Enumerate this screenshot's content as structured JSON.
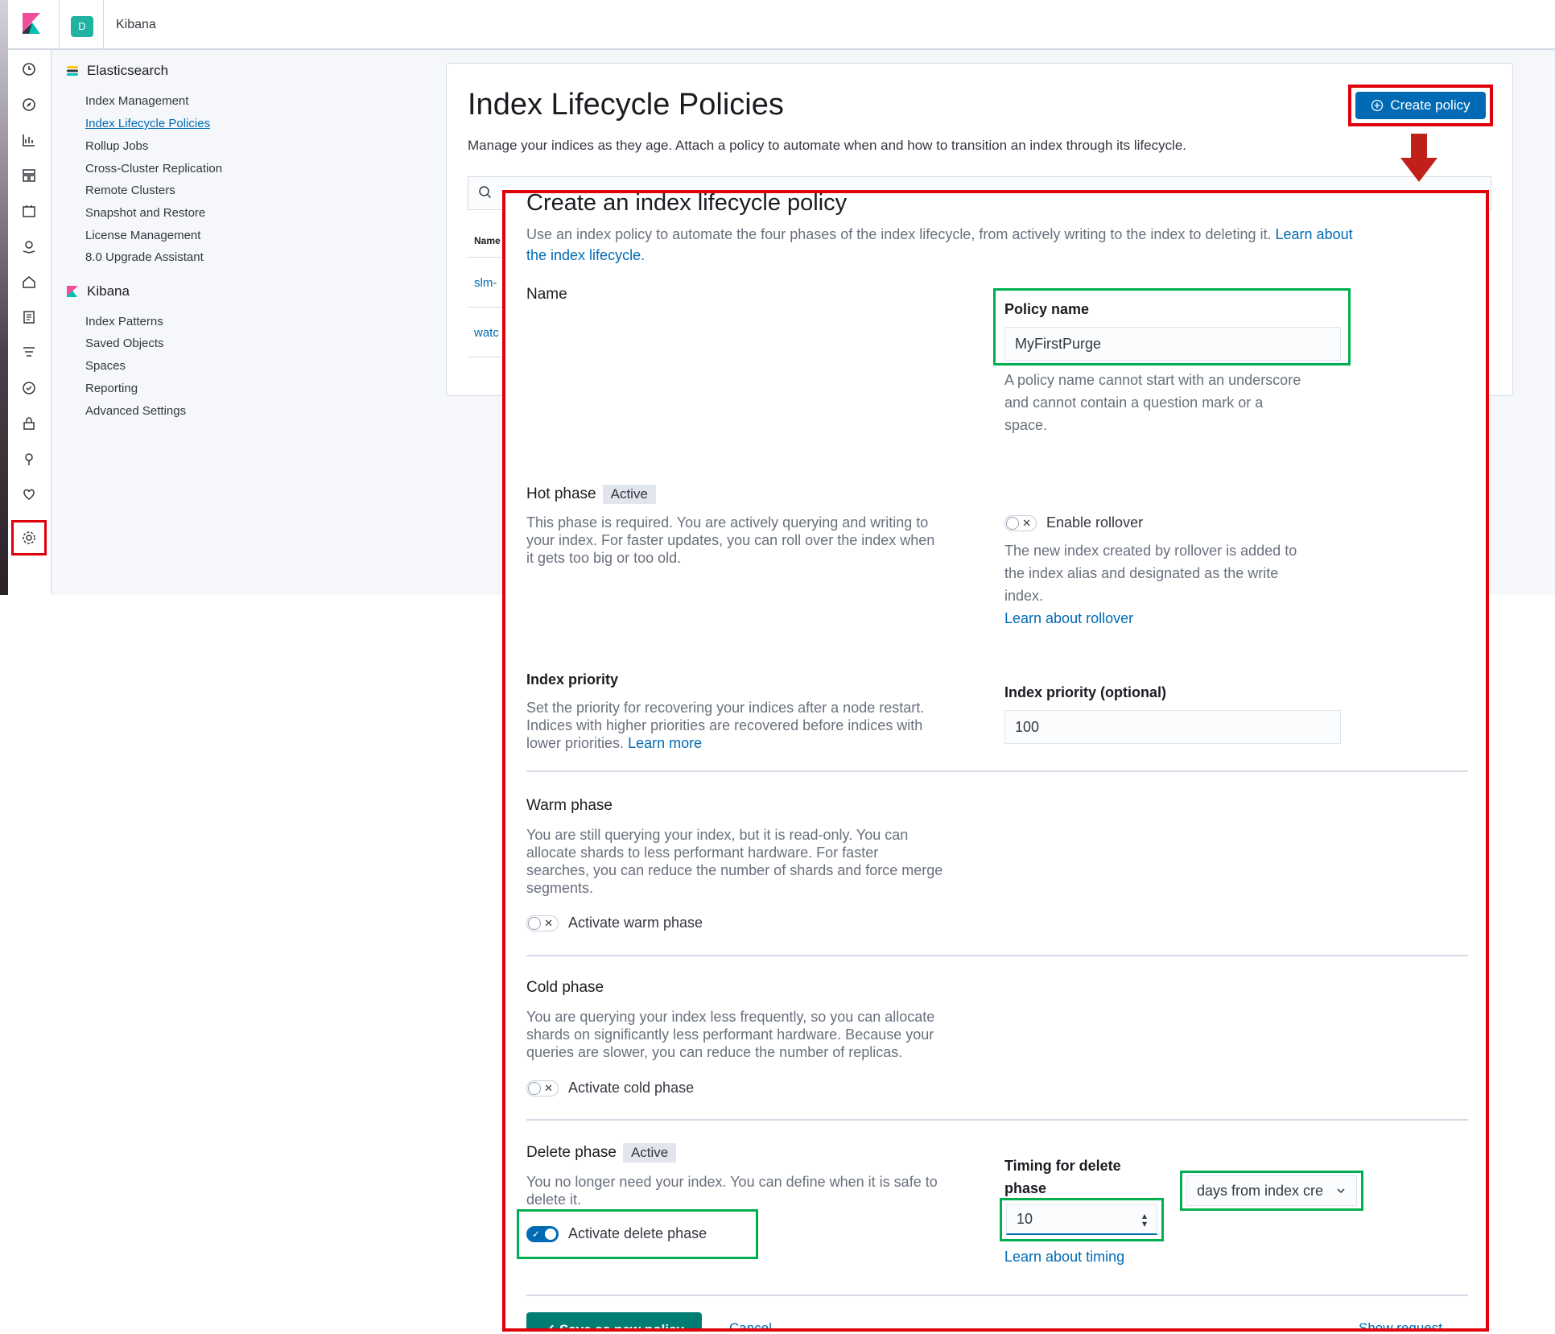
{
  "topbar": {
    "space_initial": "D",
    "app_title": "Kibana"
  },
  "sidebar": {
    "elasticsearch_title": "Elasticsearch",
    "elasticsearch_items": [
      "Index Management",
      "Index Lifecycle Policies",
      "Rollup Jobs",
      "Cross-Cluster Replication",
      "Remote Clusters",
      "Snapshot and Restore",
      "License Management",
      "8.0 Upgrade Assistant"
    ],
    "kibana_title": "Kibana",
    "kibana_items": [
      "Index Patterns",
      "Saved Objects",
      "Spaces",
      "Reporting",
      "Advanced Settings"
    ]
  },
  "main": {
    "title": "Index Lifecycle Policies",
    "description": "Manage your indices as they age. Attach a policy to automate when and how to transition an index through its lifecycle.",
    "create_button": "Create policy",
    "table_header_name": "Name",
    "rows": [
      "slm-",
      "watc"
    ]
  },
  "flyout": {
    "title": "Create an index lifecycle policy",
    "intro": "Use an index policy to automate the four phases of the index lifecycle, from actively writing to the index to deleting it.",
    "intro_link_1": "Learn about",
    "intro_link_2": "the index lifecycle.",
    "name_section": {
      "title": "Name",
      "field_label": "Policy name",
      "field_value": "MyFirstPurge",
      "help_lines": [
        "A policy name cannot start with an underscore",
        "and cannot contain a question mark or a",
        "space."
      ]
    },
    "hot_phase": {
      "title": "Hot phase",
      "badge": "Active",
      "desc_lines": [
        "This phase is required. You are actively querying and writing to",
        "your index. For faster updates, you can roll over the index when",
        "it gets too big or too old."
      ],
      "toggle_label": "Enable rollover",
      "toggle_on": false,
      "rollover_help_lines": [
        "The new index created by rollover is added to",
        "the index alias and designated as the write",
        "index."
      ],
      "rollover_link": "Learn about rollover"
    },
    "index_priority": {
      "title": "Index priority",
      "desc_lines": [
        "Set the priority for recovering your indices after a node restart.",
        "Indices with higher priorities are recovered before indices with",
        "lower priorities."
      ],
      "learn_more": "Learn more",
      "field_label": "Index priority (optional)",
      "field_value": "100"
    },
    "warm_phase": {
      "title": "Warm phase",
      "desc_lines": [
        "You are still querying your index, but it is read-only. You can",
        "allocate shards to less performant hardware. For faster",
        "searches, you can reduce the number of shards and force merge",
        "segments."
      ],
      "toggle_label": "Activate warm phase",
      "toggle_on": false
    },
    "cold_phase": {
      "title": "Cold phase",
      "desc_lines": [
        "You are querying your index less frequently, so you can allocate",
        "shards on significantly less performant hardware. Because your",
        "queries are slower, you can reduce the number of replicas."
      ],
      "toggle_label": "Activate cold phase",
      "toggle_on": false
    },
    "delete_phase": {
      "title": "Delete phase",
      "badge": "Active",
      "desc_lines": [
        "You no longer need your index. You can define when it is safe to",
        "delete it."
      ],
      "toggle_label": "Activate delete phase",
      "toggle_on": true,
      "timing_label_lines": [
        "Timing for delete",
        "phase"
      ],
      "timing_value": "10",
      "timing_unit": "days from index cre",
      "timing_link": "Learn about timing"
    },
    "footer": {
      "save_button": "Save as new policy",
      "cancel": "Cancel",
      "show_request": "Show request"
    }
  },
  "colors": {
    "accent": "#006bb4",
    "highlight_red": "#e0000b",
    "highlight_green": "#00b050",
    "save": "#017d73"
  }
}
